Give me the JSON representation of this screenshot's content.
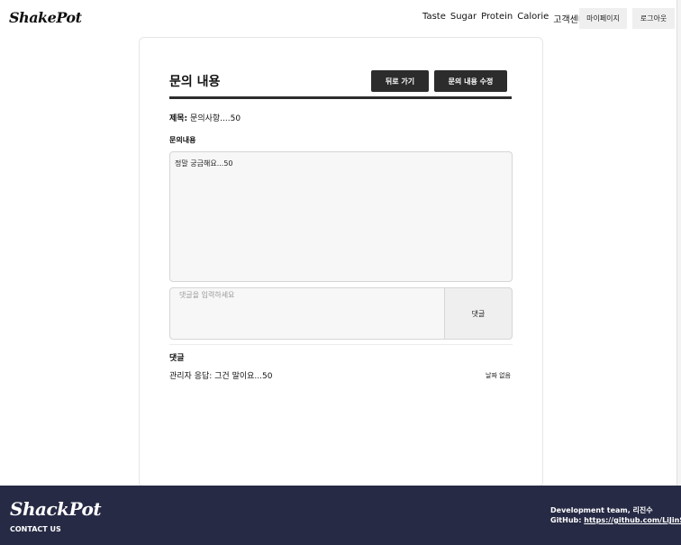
{
  "header": {
    "logo": "ShakePot",
    "nav": [
      "Taste",
      "Sugar",
      "Protein",
      "Calorie",
      "고객센터"
    ],
    "mypage_label": "마이페이지",
    "logout_label": "로그아웃"
  },
  "page": {
    "title": "문의 내용",
    "back_label": "뒤로 가기",
    "edit_label": "문의 내용 수정",
    "subject_label": "제목:",
    "subject_value": "문의사항....50",
    "content_label": "문의내용",
    "content_text": "정말 궁금해요...50",
    "comment_placeholder": "댓글을 입력하세요",
    "comment_button": "댓글",
    "comments_label": "댓글",
    "comments": [
      {
        "text": "관리자 응답: 그건 말이요...50",
        "date": "날짜 없음"
      }
    ]
  },
  "footer": {
    "logo": "ShackPot",
    "contact": "CONTACT US",
    "team": "Development team, 리진수",
    "github_label": "GitHub:",
    "github_link": "https://github.com/LiJinSu"
  },
  "colors": {
    "dark_button": "#2c2c2c",
    "footer_bg": "#262a44",
    "light_button": "#efefef"
  }
}
